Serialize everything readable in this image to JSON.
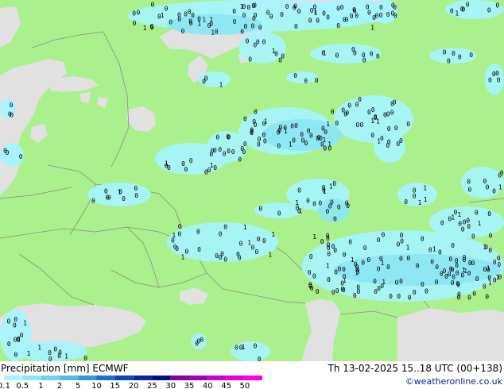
{
  "product": "Precipitation [mm]",
  "model": "ECMWF",
  "valid_time": "Th 13-02-2025 15..18 UTC (00+138)",
  "credit": "©weatheronline.co.uk",
  "legend": {
    "ticks": [
      "0.1",
      "0.5",
      "1",
      "2",
      "5",
      "10",
      "15",
      "20",
      "25",
      "30",
      "35",
      "40",
      "45",
      "50"
    ],
    "colors": [
      "#a5f5ff",
      "#8ce6f5",
      "#6ed2ee",
      "#50bbe6",
      "#3299dd",
      "#1e6ecd",
      "#1446b4",
      "#0a2896",
      "#00107d",
      "#8200a0",
      "#a000c3",
      "#c800d2",
      "#e600dc",
      "#ff00e6"
    ]
  },
  "map": {
    "colors": {
      "land": "#aaf08c",
      "sea": "#e1e1e1",
      "precip_light": "#a5f5ff",
      "precip_mid": "#8ce6f5",
      "border": "#8c8c8c"
    }
  }
}
